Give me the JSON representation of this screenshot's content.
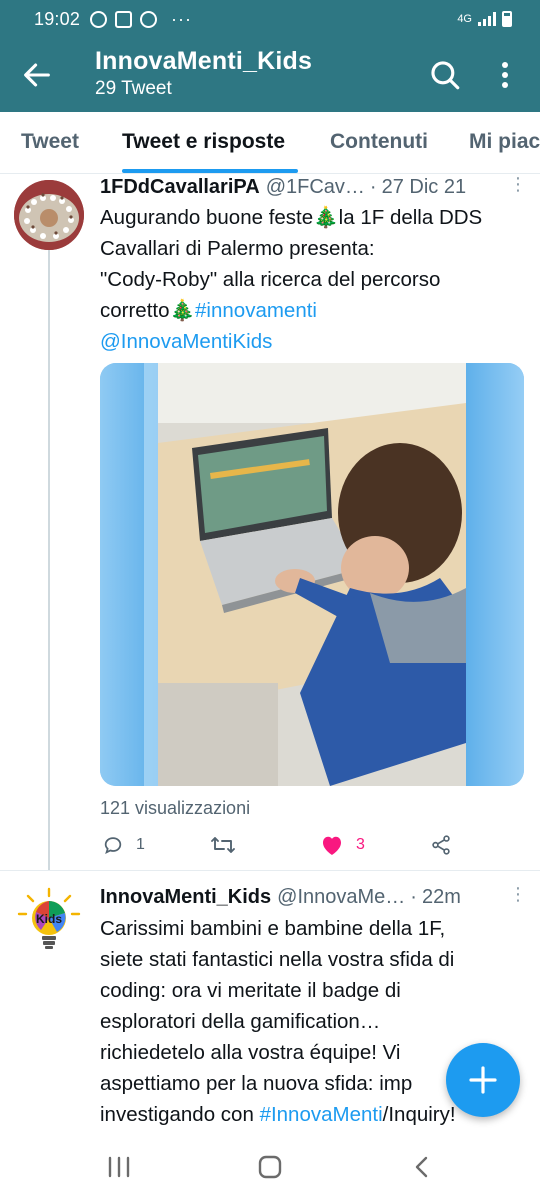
{
  "status_bar": {
    "time": "19:02",
    "notification_icons": [
      "whatsapp-icon",
      "gallery-icon",
      "pinterest-icon"
    ],
    "more": "···",
    "network": "4G"
  },
  "app_bar": {
    "title": "InnovaMenti_Kids",
    "subtitle": "29 Tweet"
  },
  "tabs": [
    {
      "label": "Tweet"
    },
    {
      "label": "Tweet e risposte"
    },
    {
      "label": "Contenuti"
    },
    {
      "label": "Mi piace"
    }
  ],
  "active_tab": "Tweet e risposte",
  "tweet1": {
    "name": "1FDdCavallariPA",
    "handle": "@1FCav…",
    "separator": "·",
    "time": "27 Dic 21",
    "line1": "Augurando buone feste🎄la 1F della DDS",
    "line2": "Cavallari di Palermo presenta:",
    "line3": "\"Cody-Roby\" alla ricerca del percorso",
    "line4_text": "corretto🎄",
    "line4_link": "#innovamenti",
    "line5_link": "@InnovaMentiKids",
    "views": "121 visualizzazioni",
    "replies": "1",
    "retweets": "",
    "likes": "3"
  },
  "tweet2": {
    "name": "InnovaMenti_Kids",
    "handle": "@InnovaMe…",
    "separator": "·",
    "time": "22m",
    "avatar_label": "Kids",
    "line1": "Carissimi bambini e bambine della 1F,",
    "line2": "siete stati fantastici nella vostra sfida di",
    "line3": "coding: ora vi meritate il badge di",
    "line4": "esploratori della gamification…",
    "line5": "richiedetelo alla vostra équipe! Vi",
    "line6": "aspettiamo per la nuova sfida: imp",
    "line7_text": "investigando con ",
    "line7_link": "#InnovaMenti",
    "line7_tail": "/Inquiry!"
  },
  "colors": {
    "brand": "#2e7783",
    "link": "#1d9bf0",
    "like": "#f91880",
    "muted": "#536471"
  }
}
